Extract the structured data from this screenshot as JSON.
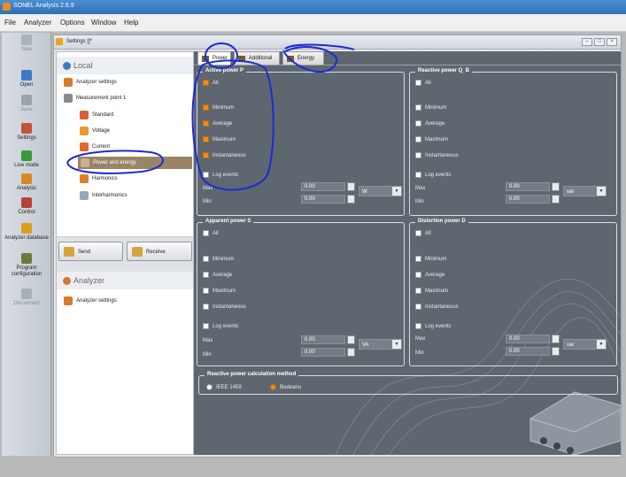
{
  "app": {
    "title": "SONEL Analysis 2.6.9"
  },
  "menu": [
    "File",
    "Analyzer",
    "Options",
    "Window",
    "Help"
  ],
  "toolbar": [
    {
      "label": "New",
      "icon": "new-icon",
      "enabled": false
    },
    {
      "label": "Open",
      "icon": "open-icon",
      "enabled": true
    },
    {
      "label": "Save",
      "icon": "save-icon",
      "enabled": false
    },
    {
      "label": "Settings",
      "icon": "settings-icon",
      "enabled": true
    },
    {
      "label": "Live mode",
      "icon": "live-mode-icon",
      "enabled": true
    },
    {
      "label": "Analysis",
      "icon": "analysis-icon",
      "enabled": true
    },
    {
      "label": "Control",
      "icon": "control-icon",
      "enabled": true
    },
    {
      "label": "Analyzer database",
      "icon": "database-icon",
      "enabled": true
    },
    {
      "label": "Program configuration",
      "icon": "configuration-icon",
      "enabled": true
    },
    {
      "label": "Disconnect",
      "icon": "disconnect-icon",
      "enabled": false
    }
  ],
  "window": {
    "title": "Settings []*"
  },
  "left": {
    "local_title": "Local",
    "analyzer_settings": "Analyzer settings",
    "measurement_point": "Measurement point 1",
    "items": [
      "Standard",
      "Voltage",
      "Current",
      "Power and energy",
      "Harmonics",
      "Interharmonics"
    ],
    "send": "Send",
    "receive": "Receive",
    "analyzer_title": "Analyzer",
    "analyzer_settings2": "Analyzer settings"
  },
  "tabs": [
    "Power",
    "Additional",
    "Energy"
  ],
  "groups": {
    "active": {
      "title": "Active power P",
      "all": "All",
      "all_checked": true,
      "options": [
        {
          "label": "Minimum",
          "checked": true
        },
        {
          "label": "Average",
          "checked": true
        },
        {
          "label": "Maximum",
          "checked": true
        },
        {
          "label": "Instantaneous",
          "checked": true
        }
      ],
      "log": "Log events",
      "max": "Max",
      "min": "Min",
      "max_val": "0.00",
      "min_val": "0.00",
      "unit": "W"
    },
    "reactive": {
      "title": "Reactive power Q_B",
      "all": "All",
      "all_checked": false,
      "options": [
        {
          "label": "Minimum",
          "checked": false
        },
        {
          "label": "Average",
          "checked": false
        },
        {
          "label": "Maximum",
          "checked": false
        },
        {
          "label": "Instantaneous",
          "checked": false
        }
      ],
      "log": "Log events",
      "max": "Max",
      "min": "Min",
      "max_val": "0.00",
      "min_val": "0.00",
      "unit": "var"
    },
    "apparent": {
      "title": "Apparent power S",
      "all": "All",
      "all_checked": false,
      "options": [
        {
          "label": "Minimum",
          "checked": false
        },
        {
          "label": "Average",
          "checked": false
        },
        {
          "label": "Maximum",
          "checked": false
        },
        {
          "label": "Instantaneous",
          "checked": false
        }
      ],
      "log": "Log events",
      "max": "Max",
      "min": "Min",
      "max_val": "0.00",
      "min_val": "0.00",
      "unit": "VA"
    },
    "distortion": {
      "title": "Distortion power D",
      "all": "All",
      "all_checked": false,
      "options": [
        {
          "label": "Minimum",
          "checked": false
        },
        {
          "label": "Average",
          "checked": false
        },
        {
          "label": "Maximum",
          "checked": false
        },
        {
          "label": "Instantaneous",
          "checked": false
        }
      ],
      "log": "Log events",
      "max": "Max",
      "min": "Min",
      "max_val": "0.00",
      "min_val": "0.00",
      "unit": "var"
    }
  },
  "method": {
    "title": "Reactive power calculation method",
    "ieee": "IEEE 1459",
    "budeanu": "Budeanu"
  }
}
